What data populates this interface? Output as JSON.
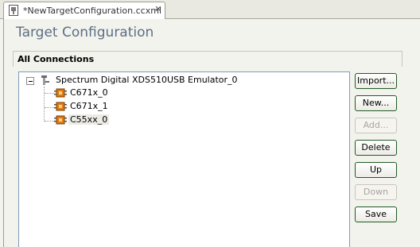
{
  "tab": {
    "title": "*NewTargetConfiguration.ccxml",
    "close": "✕"
  },
  "editor": {
    "title": "Target Configuration"
  },
  "section": {
    "title": "All Connections"
  },
  "tree": {
    "root": {
      "label": "Spectrum Digital XDS510USB Emulator_0",
      "icon": "emulator-icon"
    },
    "children": [
      {
        "label": "C671x_0",
        "icon": "cpu-icon"
      },
      {
        "label": "C671x_1",
        "icon": "cpu-icon"
      },
      {
        "label": "C55xx_0",
        "icon": "cpu-icon",
        "selected": true
      }
    ]
  },
  "buttons": {
    "import": "Import...",
    "new": "New...",
    "add": "Add...",
    "delete": "Delete",
    "up": "Up",
    "down": "Down",
    "save": "Save"
  },
  "colors": {
    "title": "#5b6e86",
    "button_border": "#1f5a23",
    "disabled_text": "#a6a59d",
    "tree_border": "#7f9db9"
  }
}
